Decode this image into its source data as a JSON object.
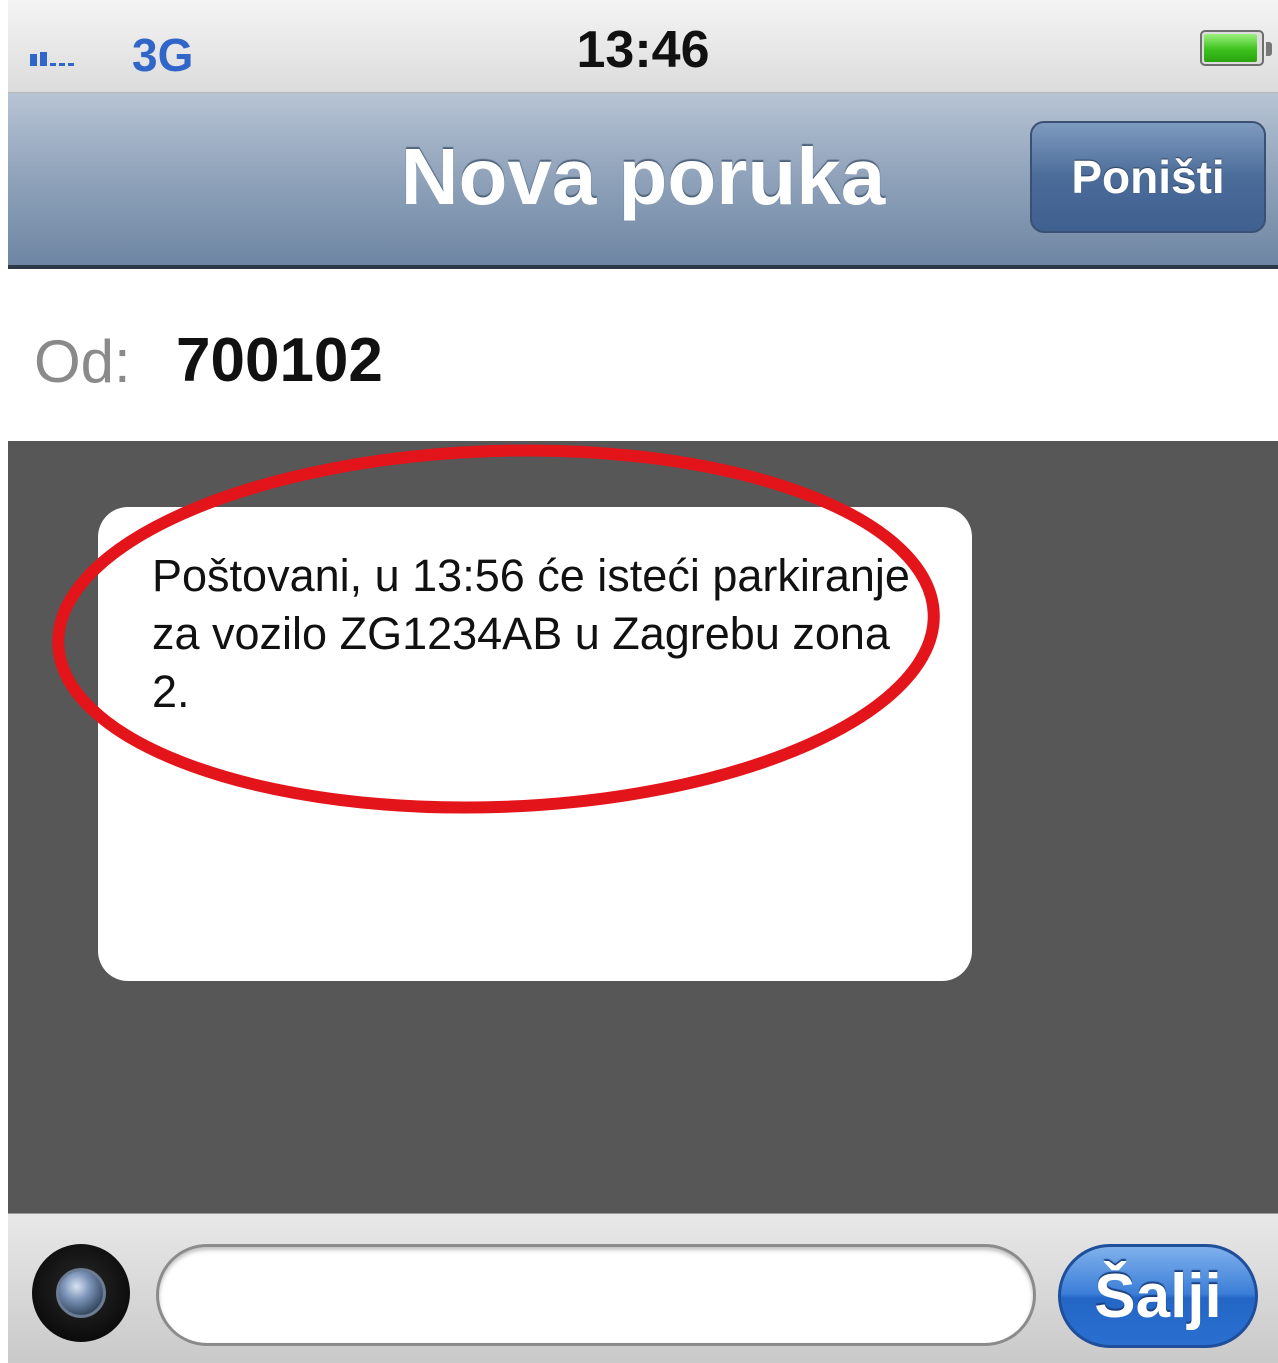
{
  "status_bar": {
    "network": "3G",
    "time": "13:46",
    "signal_bars_filled": 2,
    "signal_bars_total": 5,
    "battery_level": 0.95,
    "signal_icon": "signal-strength-icon",
    "battery_icon": "battery-icon"
  },
  "nav": {
    "title": "Nova poruka",
    "cancel_label": "Poništi"
  },
  "from": {
    "label": "Od:",
    "value": "700102"
  },
  "message": {
    "text": "Poštovani, u 13:56 će isteći parkiranje za vozilo ZG1234AB u Zagrebu zona 2.",
    "highlight_color": "#e4141b"
  },
  "compose": {
    "camera_icon": "camera-icon",
    "input_value": "",
    "send_label": "Šalji"
  },
  "colors": {
    "nav_accent": "#8fa2ba",
    "send_accent": "#2a6fd0",
    "network_text": "#2f66c8",
    "message_background": "#575757"
  }
}
